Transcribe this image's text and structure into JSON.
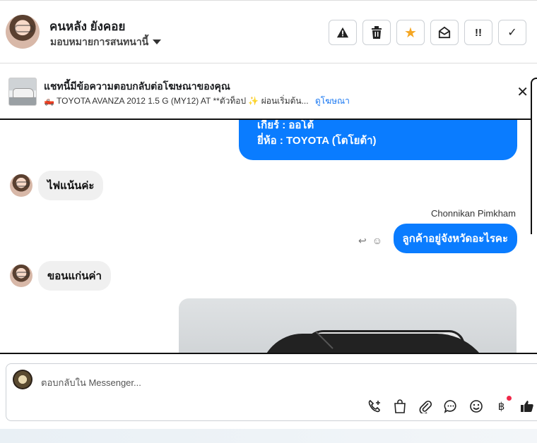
{
  "header": {
    "contact_name": "คนหลัง ยังคอย",
    "assign_label": "มอบหมายการสนทนานี้",
    "buttons": [
      {
        "name": "report-button",
        "icon": "⚠"
      },
      {
        "name": "delete-button",
        "icon": "🗑"
      },
      {
        "name": "star-button",
        "icon": "★"
      },
      {
        "name": "mark-unread-button",
        "icon": "✉"
      },
      {
        "name": "follow-up-button",
        "icon": "!!"
      },
      {
        "name": "mark-done-button",
        "icon": "✓"
      }
    ],
    "star_color": "#f5a623"
  },
  "ad": {
    "title": "แชทนี้มีข้อความตอบกลับต่อโฆษณาของคุณ",
    "subtitle": "🛻 TOYOTA AVANZA 2012 1.5 G (MY12) AT **ตัวท็อป ✨ ผ่อนเริ่มต้น...",
    "link": "ดูโฆษณา",
    "close": "✕"
  },
  "messages": {
    "car_info": [
      "เกียร์ : ออโต้",
      "ยี่ห้อ : TOYOTA (โตโยต้า)"
    ],
    "in_1": "ไฟแน้นค่ะ",
    "sender": "Chonnikan Pimkham",
    "out_1": "ลูกค้าอยู่จังหวัดอะไรคะ",
    "reply_icon": "↩",
    "react_icon": "☺",
    "in_2": "ขอนแก่นค่า"
  },
  "composer": {
    "placeholder": "ตอบกลับใน Messenger...",
    "icons": [
      "phone-plus-icon",
      "shopping-bag-icon",
      "paperclip-icon",
      "chat-bubble-icon",
      "smiley-icon",
      "baht-icon",
      "thumbs-up-icon"
    ]
  },
  "colors": {
    "brand_blue": "#0a7cff",
    "link_blue": "#1877f2",
    "notification_red": "#f02849"
  }
}
